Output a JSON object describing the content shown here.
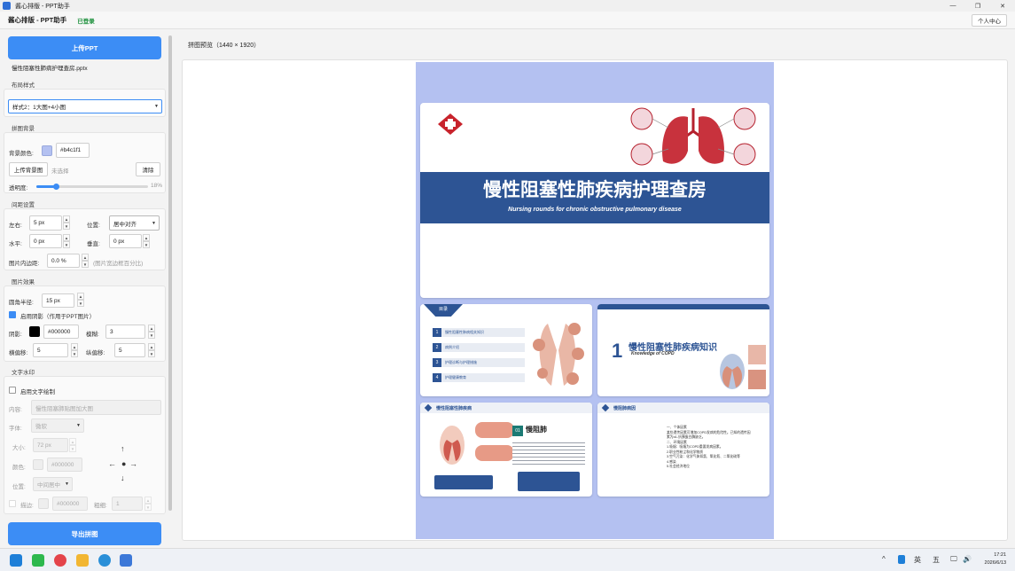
{
  "window": {
    "title": "酱心排版 - PPT助手"
  },
  "header": {
    "brand": "酱心排版 - PPT助手",
    "status": "已登录",
    "profile_button": "个人中心"
  },
  "left": {
    "upload_button": "上传PPT",
    "filename": "慢性阻塞性肺病护理查房.pptx",
    "layout": {
      "title": "布局样式",
      "selected": "样式2：1大图+4小图"
    },
    "background": {
      "title": "拼图背景",
      "color_label": "背景颜色:",
      "color_value": "#b4c1f1",
      "upload_label": "上传背景图",
      "upload_status": "未选择",
      "clear_button": "清除",
      "opacity_label": "透明度:",
      "opacity_value": "18%",
      "opacity_fraction": 0.18
    },
    "spacing": {
      "title": "间距设置",
      "lr_label": "左右:",
      "lr_value": "5 px",
      "position_label": "位置:",
      "position_value": "居中对齐",
      "h_label": "水平:",
      "h_value": "0 px",
      "v_label": "垂直:",
      "v_value": "0 px",
      "padding_label": "图片内边距:",
      "padding_value": "0.0 %",
      "padding_hint": "(图片宽边框百分比)"
    },
    "effects": {
      "title": "图片效果",
      "radius_label": "圆角半径:",
      "radius_value": "15 px",
      "shadow_toggle": "启用阴影（作用于PPT图片）",
      "shadow_label": "阴影:",
      "shadow_color": "#000000",
      "blur_label": "模糊:",
      "blur_value": "3",
      "hoffset_label": "横偏移:",
      "hoffset_value": "5",
      "voffset_label": "纵偏移:",
      "voffset_value": "5"
    },
    "watermark": {
      "title": "文字水印",
      "enable_label": "启用文字绘制",
      "content_label": "内容:",
      "content_placeholder": "慢性阻塞肺贴图加大图",
      "font_label": "字体:",
      "font_value": "微软",
      "size_label": "大小:",
      "size_value": "72 px",
      "color_label": "颜色:",
      "color_value": "#000000",
      "position_label": "位置:",
      "position_value": "中间居中",
      "stroke_label": "描边:",
      "stroke_color": "#000000",
      "stroke_width_label": "粗细:",
      "stroke_width_value": "1"
    },
    "export_button": "导出拼图"
  },
  "preview": {
    "title": "拼图预览（1440 × 1920）",
    "main_title": "慢性阻塞性肺疾病护理查房",
    "main_subtitle": "Nursing rounds for chronic obstructive pulmonary disease",
    "toc_tag": "目录",
    "toc_items": [
      {
        "num": "1",
        "text": "慢性阻塞性肺病相关知识"
      },
      {
        "num": "2",
        "text": "病例介绍"
      },
      {
        "num": "3",
        "text": "护理诊断与护理措施"
      },
      {
        "num": "4",
        "text": "护理健康教育"
      }
    ],
    "ch1_num": "1",
    "ch1_title": "慢性阻塞性肺疾病知识",
    "ch1_sub": "Knowledge of COPD",
    "copd_head": "慢性阻塞性肺疾病",
    "copd_label": "慢阻肺",
    "def_head": "慢阻肺病因",
    "def_lines": [
      "一、个体因素",
      "某些遗传因素可增加COPD发病的危险性。已知的遗传因",
      "素为α1-抗胰蛋白酶缺乏。",
      "二、环境因素",
      "1.吸烟：吸烟为COPD重要发病因素。",
      "2.职业性粉尘和化学物质",
      "3.空气污染：化学气体如氯、氧化氮、二氧化硫等",
      "4.感染",
      "5.社会经济地位"
    ]
  },
  "taskbar": {
    "tray_items": [
      "^",
      "英",
      "五"
    ],
    "time": "17:21",
    "date": "2026/6/13"
  },
  "colors": {
    "accent": "#3c8df5",
    "canvas_bg": "#b4c1f1",
    "slide_blue": "#2d5494"
  }
}
